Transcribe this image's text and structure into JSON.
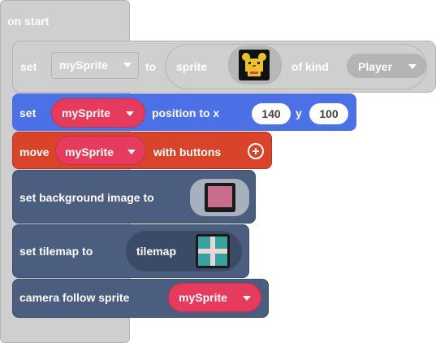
{
  "hat": {
    "label": "on start"
  },
  "set_sprite_block": {
    "set_label": "set",
    "variable": "mySprite",
    "to_label": "to",
    "sprite_label": "sprite",
    "of_kind_label": "of kind",
    "kind_value": "Player"
  },
  "position_block": {
    "set_label": "set",
    "variable": "mySprite",
    "position_label": "position to x",
    "x_value": "140",
    "y_label": "y",
    "y_value": "100"
  },
  "move_block": {
    "move_label": "move",
    "variable": "mySprite",
    "with_buttons_label": "with buttons"
  },
  "background_block": {
    "label": "set background image to"
  },
  "tilemap_block": {
    "label": "set tilemap to",
    "tilemap_label": "tilemap"
  },
  "camera_block": {
    "label": "camera follow sprite",
    "variable": "mySprite"
  },
  "colors": {
    "events": "#cfcfcf",
    "sprites": "#4c70e6",
    "controller": "#d8432a",
    "scene": "#4b5e80",
    "variable": "#e63b5c"
  },
  "icons": [
    "dropdown-arrow",
    "add-circle-icon",
    "sprite-image",
    "background-image",
    "tilemap-image"
  ]
}
